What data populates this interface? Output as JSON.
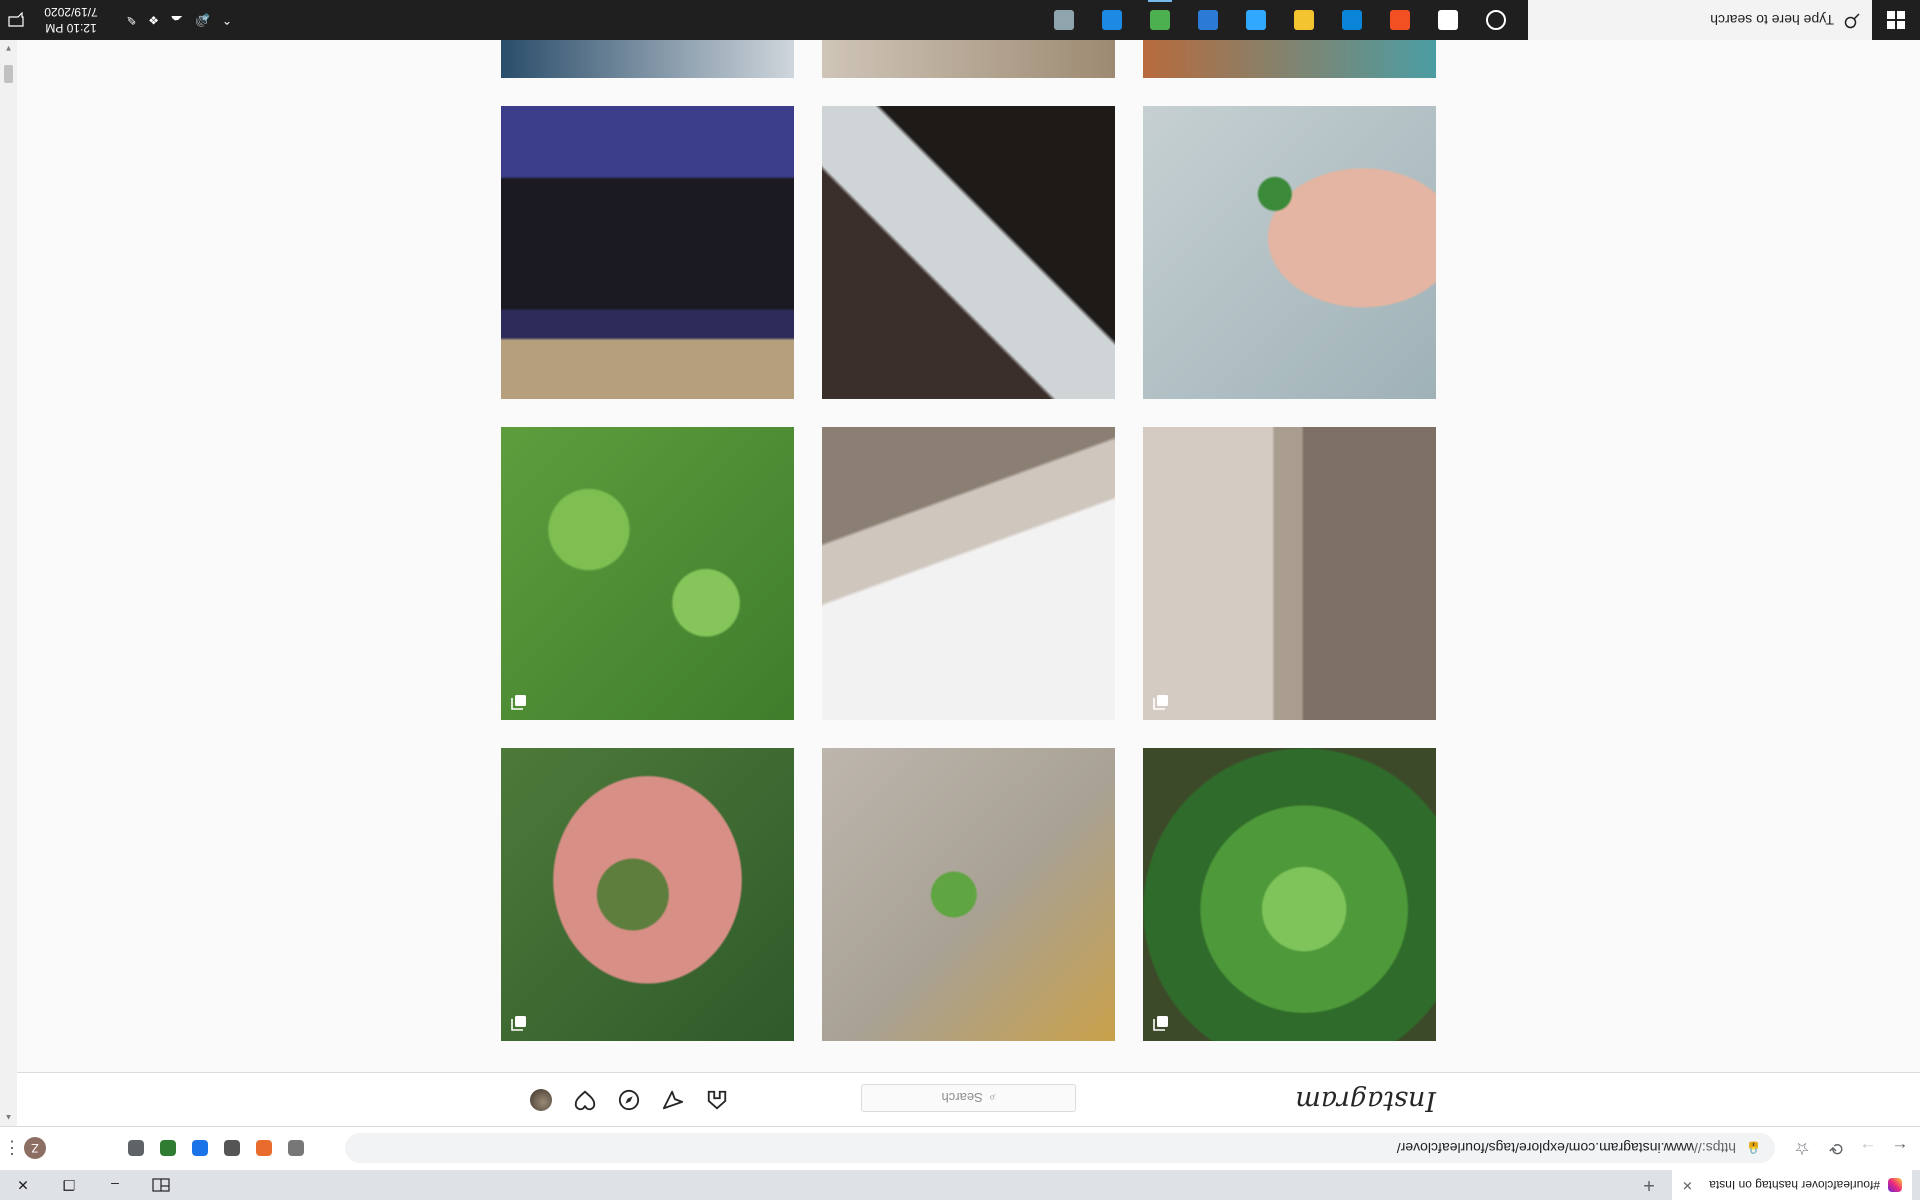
{
  "browser": {
    "tab": {
      "title": "#fourleafclover hashtag on Insta",
      "close_glyph": "✕"
    },
    "new_tab_glyph": "+",
    "window": {
      "minimize_glyph": "–",
      "maximize_glyph": "❐",
      "close_glyph": "✕"
    },
    "nav": {
      "back_glyph": "←",
      "forward_glyph": "→",
      "reload_glyph": "⟳",
      "bookmark_glyph": "☆"
    },
    "omnibox": {
      "lock_glyph": "🔒",
      "url_scheme": "https://",
      "url_rest": "www.instagram.com/explore/tags/fourleafclover/"
    },
    "extensions": [
      {
        "name": "extension-icon-1",
        "color": "#777777"
      },
      {
        "name": "extension-icon-2",
        "color": "#e86c2c"
      },
      {
        "name": "extension-icon-3",
        "color": "#555555"
      },
      {
        "name": "extension-icon-4",
        "color": "#1a73e8"
      },
      {
        "name": "extension-icon-5",
        "color": "#2e7d32"
      },
      {
        "name": "puzzle-icon",
        "color": "#5f6368"
      }
    ],
    "profile_initial": "Z",
    "menu_glyph": "⋮"
  },
  "instagram": {
    "logo": "Instagram",
    "search_placeholder": "Search",
    "search_icon_glyph": "⌕",
    "nav_icons": [
      "home-icon",
      "direct-icon",
      "explore-icon",
      "activity-icon",
      "profile-avatar"
    ]
  },
  "grid": {
    "tiles": [
      {
        "name": "post-clover-waterdrops",
        "multi": true,
        "bg": "radial-gradient(circle at 45% 45%, #7fc45a 0 18%, #4e9a3a 19% 45%, #2f6b2a 46% 70%, #3d4a2a 71%)"
      },
      {
        "name": "post-clover-fingers-orange",
        "multi": false,
        "bg": "radial-gradient(circle at 55% 50%, #5fa541 0 10%, transparent 11%), linear-gradient(135deg,#c9a14a 0%,#a8a194 45%,#bdb6ad 100%)"
      },
      {
        "name": "post-clover-palm",
        "multi": true,
        "bg": "radial-gradient(circle at 55% 50%, #5e7e3e 0 16%, transparent 17%), radial-gradient(ellipse at 50% 55%, #d88f86 0 45%, transparent 46%), linear-gradient(135deg,#2f5a2a,#4d7a3a)"
      },
      {
        "name": "post-cat-shadow-bowls",
        "multi": true,
        "bg": "linear-gradient(90deg,#7e6f66 0 45%, #a89d8f 46% 55%, #d4cbc2 56%)"
      },
      {
        "name": "post-white-shelf",
        "multi": false,
        "bg": "linear-gradient(160deg,#f2f2f2 0 55%, #cfc6bd 56% 70%, #8b7f74 71%)"
      },
      {
        "name": "post-green-clover-patch",
        "multi": true,
        "bg": "radial-gradient(circle at 30% 40%, #86c55a 0 12%, transparent 13%), radial-gradient(circle at 70% 65%, #7fbf52 0 14%, transparent 15%), linear-gradient(135deg,#3f7d2c,#5e9d3d)"
      },
      {
        "name": "post-clover-fingers-bucket",
        "multi": false,
        "bg": "radial-gradient(circle at 55% 70%, #3b8a3a 0 6%, transparent 7%), radial-gradient(ellipse at 25% 55%, #e3b5a2 0 30%, transparent 31%), linear-gradient(135deg,#9fb2b8,#c6d0d2)"
      },
      {
        "name": "post-window-frame",
        "multi": false,
        "bg": "linear-gradient(45deg,#1e1a18 0 40%, #cfd4d6 41% 60%, #3a2f2a 61%)"
      },
      {
        "name": "post-train-window",
        "multi": false,
        "bg": "linear-gradient(180deg,#b69f7c 0 20%, #2e2b5b 21% 30%, #1b1a22 31% 75%, #3b3d8a 76%)"
      },
      {
        "name": "post-cut-top-1",
        "multi": false,
        "bg": "linear-gradient(90deg,#4b9da3,#b86a3c)"
      },
      {
        "name": "post-cut-top-2",
        "multi": false,
        "bg": "linear-gradient(90deg,#9d8a72,#cfc5b8)"
      },
      {
        "name": "post-cut-top-3",
        "multi": false,
        "bg": "linear-gradient(90deg,#cfd6dc,#2a4d6a)"
      }
    ]
  },
  "taskbar": {
    "search_placeholder": "Type here to search",
    "time": "12:10 PM",
    "date": "7/19/2020",
    "apps": [
      "cortana-icon",
      "task-view-icon",
      "store-icon",
      "edge-icon",
      "file-explorer-icon",
      "photoshop-icon",
      "photos-icon",
      "chrome-icon",
      "settings-icon",
      "app-icon"
    ]
  }
}
